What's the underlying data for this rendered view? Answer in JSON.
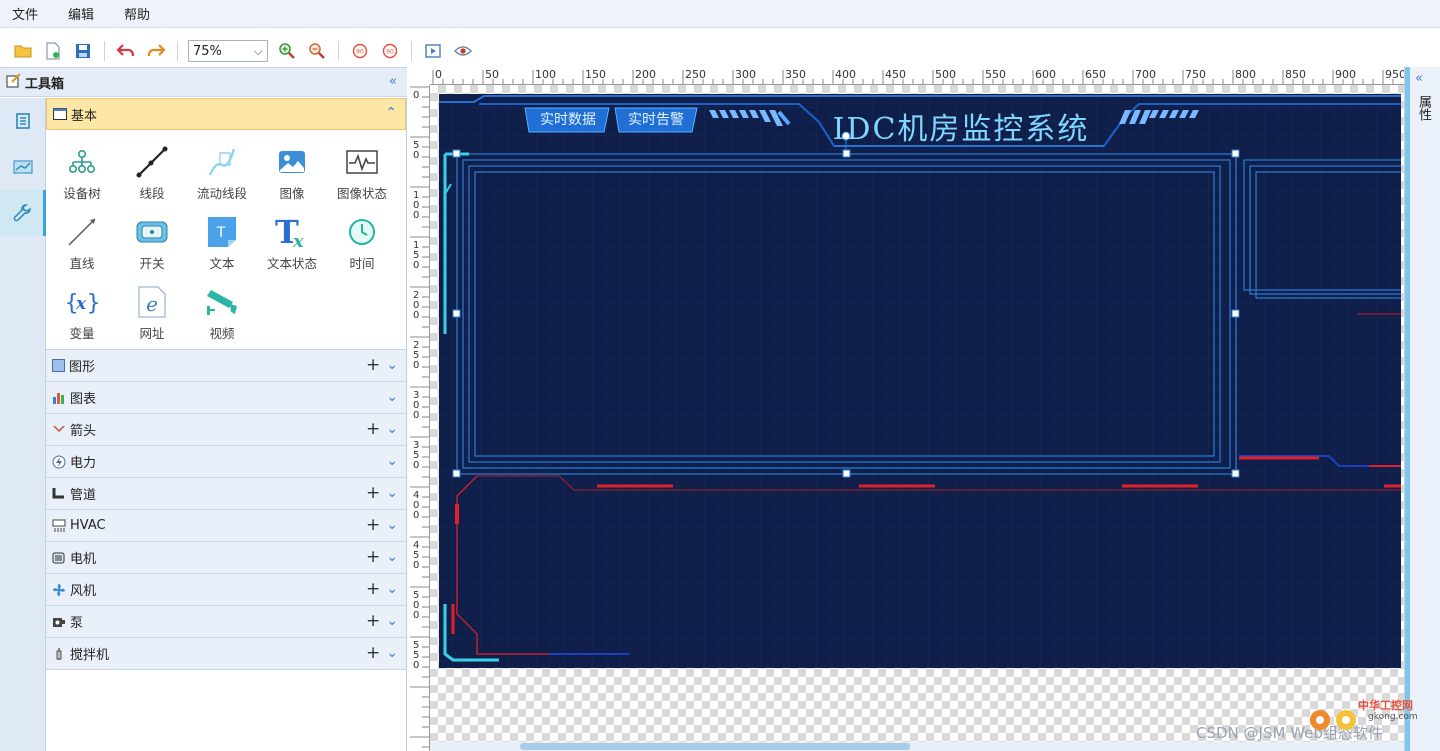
{
  "menu": [
    "文件",
    "编辑",
    "帮助"
  ],
  "toolbar": {
    "zoom": "75%"
  },
  "toolbox": {
    "title": "工具箱",
    "basic_label": "基本",
    "basic_items": [
      "设备树",
      "线段",
      "流动线段",
      "图像",
      "图像状态",
      "直线",
      "开关",
      "文本",
      "文本状态",
      "时间",
      "变量",
      "网址",
      "视频"
    ],
    "sections": [
      "图形",
      "图表",
      "箭头",
      "电力",
      "管道",
      "HVAC",
      "电机",
      "风机",
      "泵",
      "搅拌机"
    ]
  },
  "ruler": {
    "h": [
      "0",
      "50",
      "100",
      "150",
      "200",
      "250",
      "300",
      "350",
      "400",
      "450",
      "500",
      "550",
      "600",
      "650",
      "700",
      "750",
      "800",
      "850",
      "900",
      "950"
    ],
    "v": [
      "0",
      "50",
      "100",
      "150",
      "200",
      "250",
      "300",
      "350",
      "400",
      "450",
      "500",
      "550"
    ]
  },
  "scene": {
    "title": "IDC机房监控系统",
    "btn1": "实时数据",
    "btn2": "实时告警"
  },
  "properties_label": "属性",
  "watermark": "CSDN @JSM Web组态软件",
  "logo": {
    "top": "中华工控网",
    "bottom": "gkong.com"
  },
  "colors": {
    "accent": "#33a8d8",
    "scene_bg": "#0f1f4a",
    "title": "#7fd6ff",
    "red": "#e0202a"
  }
}
